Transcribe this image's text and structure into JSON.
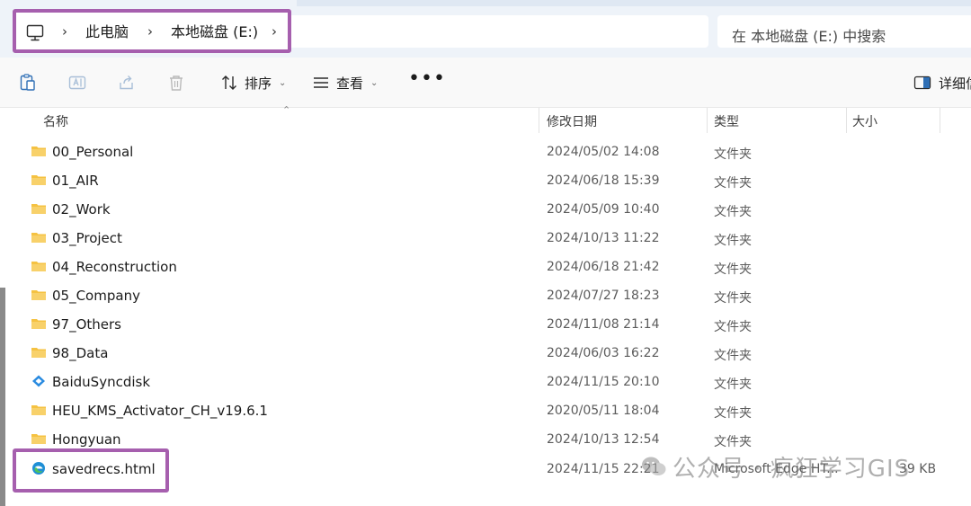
{
  "breadcrumb": {
    "items": [
      "此电脑",
      "本地磁盘 (E:)"
    ]
  },
  "search": {
    "placeholder": "在 本地磁盘 (E:) 中搜索"
  },
  "toolbar": {
    "sort_label": "排序",
    "view_label": "查看",
    "more_label": "•••",
    "details_label": "详细信"
  },
  "columns": {
    "name": "名称",
    "date": "修改日期",
    "type": "类型",
    "size": "大小"
  },
  "files": [
    {
      "name": "00_Personal",
      "date": "2024/05/02 14:08",
      "type": "文件夹",
      "size": "",
      "icon": "folder-icon"
    },
    {
      "name": "01_AIR",
      "date": "2024/06/18 15:39",
      "type": "文件夹",
      "size": "",
      "icon": "folder-icon"
    },
    {
      "name": "02_Work",
      "date": "2024/05/09 10:40",
      "type": "文件夹",
      "size": "",
      "icon": "folder-icon"
    },
    {
      "name": "03_Project",
      "date": "2024/10/13 11:22",
      "type": "文件夹",
      "size": "",
      "icon": "folder-icon"
    },
    {
      "name": "04_Reconstruction",
      "date": "2024/06/18 21:42",
      "type": "文件夹",
      "size": "",
      "icon": "folder-icon"
    },
    {
      "name": "05_Company",
      "date": "2024/07/27 18:23",
      "type": "文件夹",
      "size": "",
      "icon": "folder-icon"
    },
    {
      "name": "97_Others",
      "date": "2024/11/08 21:14",
      "type": "文件夹",
      "size": "",
      "icon": "folder-icon"
    },
    {
      "name": "98_Data",
      "date": "2024/06/03 16:22",
      "type": "文件夹",
      "size": "",
      "icon": "folder-icon"
    },
    {
      "name": "BaiduSyncdisk",
      "date": "2024/11/15 20:10",
      "type": "文件夹",
      "size": "",
      "icon": "baidu-sync-icon"
    },
    {
      "name": "HEU_KMS_Activator_CH_v19.6.1",
      "date": "2020/05/11 18:04",
      "type": "文件夹",
      "size": "",
      "icon": "folder-icon"
    },
    {
      "name": "Hongyuan",
      "date": "2024/10/13 12:54",
      "type": "文件夹",
      "size": "",
      "icon": "folder-icon"
    },
    {
      "name": "savedrecs.html",
      "date": "2024/11/15 22:21",
      "type": "Microsoft Edge HT...",
      "size": "39 KB",
      "icon": "edge-icon"
    }
  ],
  "watermark": {
    "text": "公众号 · 疯狂学习GIS"
  },
  "colors": {
    "highlight": "#a65fae",
    "folder": "#f5c242",
    "edge": "#1f8fd6",
    "address_bg": "#eef3f9"
  }
}
